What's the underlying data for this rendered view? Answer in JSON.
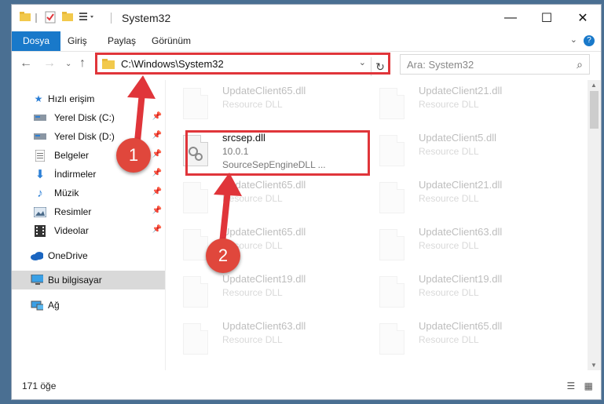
{
  "window": {
    "title": "System32",
    "controls": {
      "minimize": "—",
      "maximize": "☐",
      "close": "✕"
    }
  },
  "ribbon": {
    "tabs": [
      "Dosya",
      "Giriş",
      "Paylaş",
      "Görünüm"
    ],
    "help": "?"
  },
  "address": {
    "path": "C:\\Windows\\System32",
    "search_placeholder": "Ara: System32"
  },
  "nav": {
    "items": [
      {
        "label": "Hızlı erişim",
        "icon": "star-icon"
      },
      {
        "label": "Yerel Disk (C:)",
        "icon": "drive-icon"
      },
      {
        "label": "Yerel Disk (D:)",
        "icon": "drive-icon"
      },
      {
        "label": "Belgeler",
        "icon": "documents-icon"
      },
      {
        "label": "İndirmeler",
        "icon": "download-icon"
      },
      {
        "label": "Müzik",
        "icon": "music-icon"
      },
      {
        "label": "Resimler",
        "icon": "pictures-icon"
      },
      {
        "label": "Videolar",
        "icon": "videos-icon"
      },
      {
        "label": "OneDrive",
        "icon": "cloud-icon"
      },
      {
        "label": "Bu bilgisayar",
        "icon": "computer-icon"
      },
      {
        "label": "Ağ",
        "icon": "network-icon"
      }
    ]
  },
  "files": {
    "left": [
      {
        "name": "UpdateClient65.dll",
        "type": "Resource DLL"
      },
      {
        "name": "srcsep.dll",
        "version": "10.0.1",
        "desc": "SourceSepEngineDLL ..."
      },
      {
        "name": "UpdateClient65.dll",
        "type": "Resource DLL"
      },
      {
        "name": "UpdateClient65.dll",
        "type": "Resource DLL"
      },
      {
        "name": "UpdateClient19.dll",
        "type": "Resource DLL"
      },
      {
        "name": "UpdateClient63.dll",
        "type": "Resource DLL"
      }
    ],
    "right": [
      {
        "name": "UpdateClient21.dll",
        "type": "Resource DLL"
      },
      {
        "name": "UpdateClient5.dll",
        "type": "Resource DLL"
      },
      {
        "name": "UpdateClient21.dll",
        "type": "Resource DLL"
      },
      {
        "name": "UpdateClient63.dll",
        "type": "Resource DLL"
      },
      {
        "name": "UpdateClient19.dll",
        "type": "Resource DLL"
      },
      {
        "name": "UpdateClient65.dll",
        "type": "Resource DLL"
      }
    ]
  },
  "status": {
    "count": "171 öğe"
  },
  "annotations": {
    "step1": "1",
    "step2": "2"
  },
  "colors": {
    "accent": "#1979ca",
    "highlight": "#e0353a"
  }
}
